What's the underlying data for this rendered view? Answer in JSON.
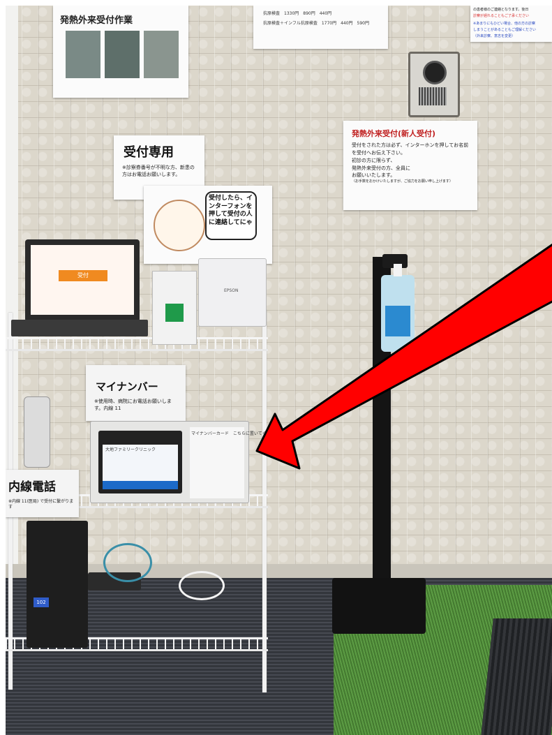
{
  "photo": {
    "posters": {
      "top_left_title": "発熱外来受付作業",
      "top_center_rows": [
        "抗原検査　1330円　890円　440円",
        "抗原検査＋インフル抗原検査　1770円　440円　590円"
      ],
      "top_right_lines": [
        "の患者様のご連絡となります。後日",
        "診察が遅れることもご了承ください",
        "※あまりにもひどい場合、他の方の診察",
        "しまうことがあることもご理解ください",
        "（外来診察、意志を変更）"
      ],
      "reception_title": "受付専用",
      "reception_note": "※診察券番号が不明な方、新患の方はお電話お願いします。",
      "fever_title": "発熱外来受付(新人受付)",
      "fever_lines": [
        "受付をされた方は必ず、インターホンを押してお名前を受付へお伝え下さい。",
        "初診の方に限らず、",
        "発熱外来受付の方、全員に",
        "お願いいたします。",
        "（お手数をおかけいたしますが、ご協力をお願い申し上げます）"
      ],
      "cat_bubble": "受付したら、インターフォンを押して受付の人に連絡してにゃ",
      "mynumber_title": "マイナンバー",
      "mynumber_note": "※使用時、病院にお電話お願いします。内線 11",
      "extension_title": "内線電話",
      "extension_note": "※内線 11(医局) で受付に繋がります"
    },
    "devices": {
      "laptop_button": "受付",
      "printer_brand": "EPSON",
      "kiosk_screen_title": "大地ファミリークリニック",
      "kiosk_card_slot": "マイナンバーカード　こちらに置いてください",
      "ups_display": "102"
    },
    "colors": {
      "arrow": "#ff0000",
      "arrow_outline": "#000000",
      "accent_orange": "#f08a20",
      "kiosk_blue": "#1c6ac8"
    }
  }
}
